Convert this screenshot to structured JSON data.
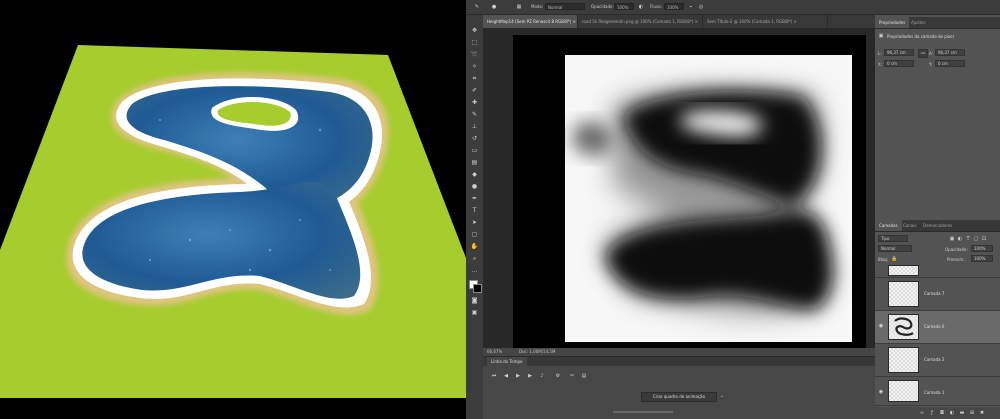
{
  "game": {
    "colors": {
      "grass": "#a6cc2e",
      "sand": "#e6c48a",
      "water": "#1f5a94",
      "foam": "#ffffff",
      "background": "#000000"
    }
  },
  "photoshop": {
    "options": {
      "mode_label": "Modo:",
      "mode_value": "Normal",
      "opacity_label": "Opacidade:",
      "opacity_value": "100%",
      "flow_label": "Fluxo:",
      "flow_value": "100%"
    },
    "tabs": [
      {
        "label": "HeightMap14 (Sem PZ Renascit 8 RGB/8*) ×",
        "active": true
      },
      {
        "label": "road 5k Resgeremdin.png @ 100% (Camada 1, RGB/8*) ×",
        "active": false
      },
      {
        "label": "Sem Título-2 @ 100% (Camada 1, RGB/8*) ×",
        "active": false
      }
    ],
    "status": {
      "zoom": "66,67%",
      "doc": "Doc: 1,00M/14,5M"
    },
    "timeline": {
      "tab": "Linha do Tempo",
      "create_button": "Criar quadro de animação"
    },
    "properties": {
      "tabs": [
        "Propriedades",
        "Ajustes"
      ],
      "title": "Propriedades da camada de pixel",
      "w_label": "L:",
      "w_value": "96,37 cm",
      "h_label": "A:",
      "h_value": "96,37 cm",
      "x_label": "X:",
      "x_value": "0 cm",
      "y_label": "Y:",
      "y_value": "0 cm",
      "link": "GO"
    },
    "layers": {
      "tabs": [
        "Camadas",
        "Canais",
        "Demarcadores"
      ],
      "filter": "Tipo",
      "blend": "Normal",
      "opacity_label": "Opacidade:",
      "opacity_value": "100%",
      "lock_label": "Bloq:",
      "fill_label": "Preench.:",
      "fill_value": "100%",
      "items": [
        {
          "name": "",
          "visible": false,
          "selected": false
        },
        {
          "name": "Camada 7",
          "visible": false,
          "selected": false
        },
        {
          "name": "Camada 6",
          "visible": true,
          "selected": true
        },
        {
          "name": "Camada 2",
          "visible": false,
          "selected": false
        },
        {
          "name": "Camada 1",
          "visible": true,
          "selected": false
        }
      ]
    }
  }
}
